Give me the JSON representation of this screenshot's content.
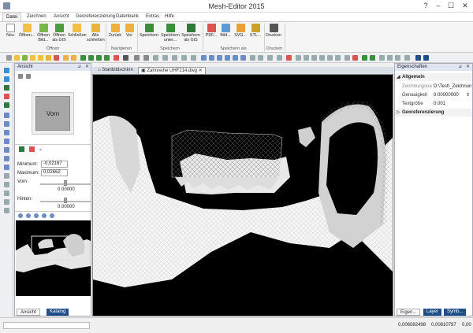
{
  "window": {
    "title": "Mesh-Editor 2015",
    "controls": [
      "?",
      "–",
      "☐",
      "✕"
    ]
  },
  "menu_tabs": [
    "Datei",
    "Zeichnen",
    "Ansicht",
    "Georeferenzierung",
    "Datenbank",
    "Extras",
    "Hilfe"
  ],
  "active_tab": "Datei",
  "ribbon": {
    "groups": [
      "Öffnen",
      "Navigieren",
      "Speichern",
      "Speichern als",
      "Drucken"
    ],
    "buttons": [
      {
        "label": "Neu",
        "icon": "new-document-icon"
      },
      {
        "label": "Öffnen...",
        "icon": "folder-open-icon"
      },
      {
        "label": "Öffnen Bild...",
        "icon": "open-image-icon"
      },
      {
        "label": "Öffnen als GIS",
        "icon": "open-gis-icon"
      },
      {
        "label": "Schließen",
        "icon": "close-file-icon"
      },
      {
        "label": "Alle schließen",
        "icon": "close-all-icon"
      },
      {
        "label": "Zurück",
        "icon": "back-icon"
      },
      {
        "label": "Vor",
        "icon": "forward-icon"
      },
      {
        "label": "Speichern",
        "icon": "save-icon"
      },
      {
        "label": "Speichern unter...",
        "icon": "save-as-icon"
      },
      {
        "label": "Speichern als GIS",
        "icon": "save-gis-icon"
      },
      {
        "label": "PDF...",
        "icon": "pdf-icon"
      },
      {
        "label": "Bild...",
        "icon": "image-icon"
      },
      {
        "label": "SVG...",
        "icon": "svg-icon"
      },
      {
        "label": "STL...",
        "icon": "stl-icon"
      },
      {
        "label": "Drucken",
        "icon": "printer-icon"
      }
    ]
  },
  "ansicht_panel": {
    "title": "Ansicht",
    "view_label": "Vorn",
    "minimum_label": "Minimum:",
    "minimum_value": "-0,02167",
    "maximum_label": "Maximum:",
    "maximum_value": "0,02662",
    "vorn_label": "Vorn:",
    "vorn_value": "0.00000",
    "vorn_level": 0.5,
    "hinten_label": "Hinten:",
    "hinten_value": "0.00000",
    "hinten_level": 0.5,
    "bottom_tabs": [
      "Ansicht",
      "Katalog"
    ]
  },
  "doc_tabs": [
    "Startbildschirm",
    "Zahnreihe UHF214.dwg"
  ],
  "active_doc": "Zahnreihe UHF214.dwg",
  "properties": {
    "title": "Eigenschaften",
    "section_general": "Allgemein",
    "rows": [
      {
        "key": "Zeichnungsna",
        "value": "D:\\Test\\_Zeichnun"
      },
      {
        "key": "Genauigkeit",
        "value": "0.00000000"
      },
      {
        "key": "Textgröße",
        "value": "0.001"
      }
    ],
    "section_geo": "Georeferenzierung",
    "bottom_tabs": [
      "Eigen...",
      "Layer",
      "Symb..."
    ]
  },
  "status": {
    "x": "0,006082498",
    "y": "0,00810797",
    "z": "0,00"
  },
  "colors": {
    "accent": "#1f4f8a",
    "canvas": "#000000",
    "panel_header": "#dfe6f1"
  }
}
